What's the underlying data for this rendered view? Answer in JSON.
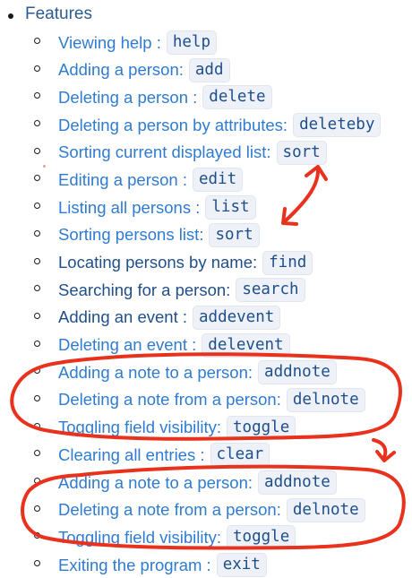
{
  "features": {
    "label": "Features",
    "items": [
      {
        "label": "Viewing help :",
        "command": "help",
        "style": "link"
      },
      {
        "label": "Adding a person:",
        "command": "add",
        "style": "link"
      },
      {
        "label": "Deleting a person :",
        "command": "delete",
        "style": "link"
      },
      {
        "label": "Deleting a person by attributes:",
        "command": "deleteby",
        "style": "link"
      },
      {
        "label": "Sorting current displayed list:",
        "command": "sort",
        "style": "link"
      },
      {
        "label": "Editing a person :",
        "command": "edit",
        "style": "link"
      },
      {
        "label": "Listing all persons :",
        "command": "list",
        "style": "link"
      },
      {
        "label": "Sorting persons list:",
        "command": "sort",
        "style": "link"
      },
      {
        "label": "Locating persons by name:",
        "command": "find",
        "style": "dark"
      },
      {
        "label": "Searching for a person:",
        "command": "search",
        "style": "dark"
      },
      {
        "label": "Adding an event :",
        "command": "addevent",
        "style": "dark"
      },
      {
        "label": "Deleting an event :",
        "command": "delevent",
        "style": "link"
      },
      {
        "label": "Adding a note to a person:",
        "command": "addnote",
        "style": "link"
      },
      {
        "label": "Deleting a note from a person:",
        "command": "delnote",
        "style": "link"
      },
      {
        "label": "Toggling field visibility:",
        "command": "toggle",
        "style": "link"
      },
      {
        "label": "Clearing all entries :",
        "command": "clear",
        "style": "link"
      },
      {
        "label": "Adding a note to a person:",
        "command": "addnote",
        "style": "link"
      },
      {
        "label": "Deleting a note from a person:",
        "command": "delnote",
        "style": "link"
      },
      {
        "label": "Toggling field visibility:",
        "command": "toggle",
        "style": "link"
      },
      {
        "label": "Exiting the program :",
        "command": "exit",
        "style": "link"
      }
    ]
  },
  "colors": {
    "link": "#2f7bd0",
    "dark": "#1f4f8a",
    "code_bg": "#eef1f7",
    "annotation": "#e8321e"
  }
}
